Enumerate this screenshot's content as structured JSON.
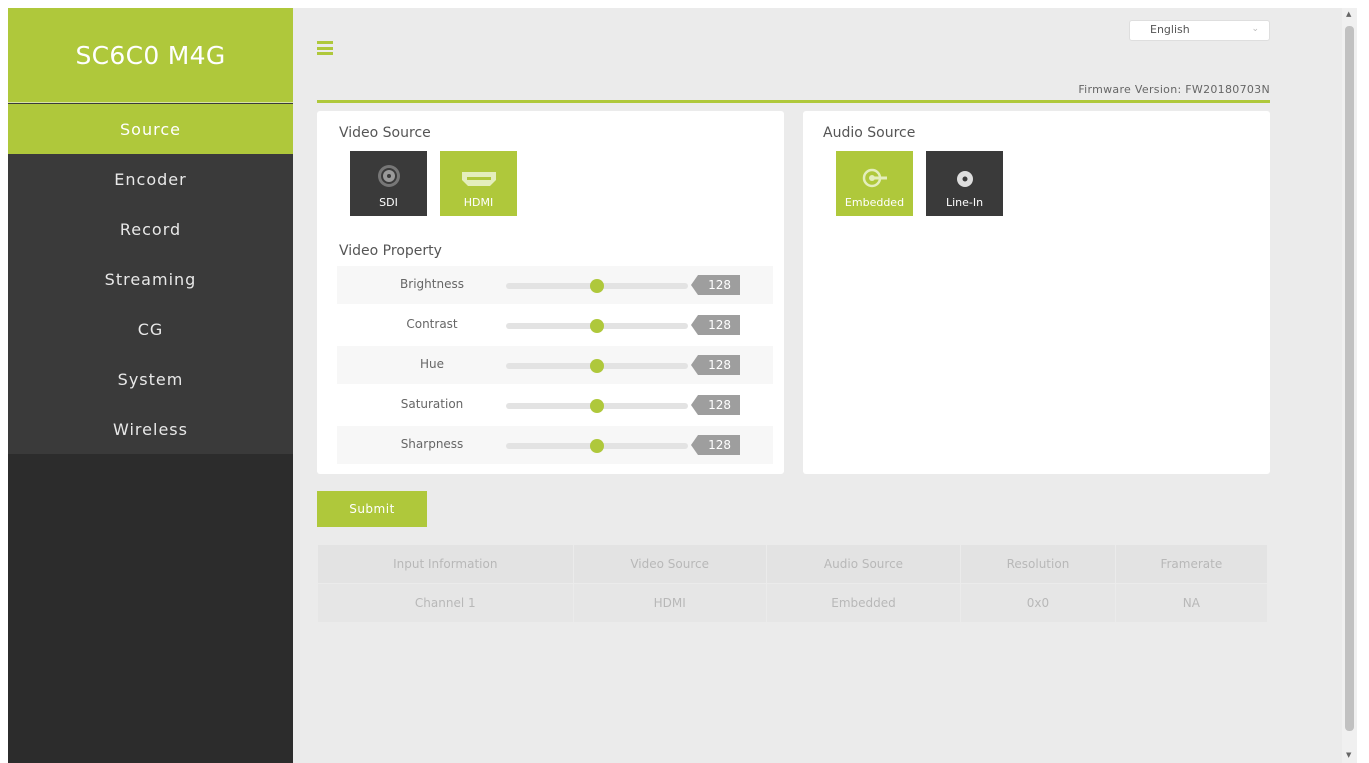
{
  "brand": "SC6C0 M4G",
  "nav": [
    "Source",
    "Encoder",
    "Record",
    "Streaming",
    "CG",
    "System",
    "Wireless"
  ],
  "active_nav": 0,
  "language": "English",
  "firmware": "Firmware Version: FW20180703N",
  "video_source": {
    "title": "Video Source",
    "options": [
      {
        "label": "SDI",
        "selected": false,
        "icon": "sdi-connector-icon"
      },
      {
        "label": "HDMI",
        "selected": true,
        "icon": "hdmi-port-icon"
      }
    ]
  },
  "audio_source": {
    "title": "Audio Source",
    "options": [
      {
        "label": "Embedded",
        "selected": true,
        "icon": "embedded-audio-icon"
      },
      {
        "label": "Line-In",
        "selected": false,
        "icon": "line-in-jack-icon"
      }
    ]
  },
  "video_property": {
    "title": "Video Property",
    "min": 0,
    "max": 255,
    "items": [
      {
        "label": "Brightness",
        "value": "128"
      },
      {
        "label": "Contrast",
        "value": "128"
      },
      {
        "label": "Hue",
        "value": "128"
      },
      {
        "label": "Saturation",
        "value": "128"
      },
      {
        "label": "Sharpness",
        "value": "128"
      }
    ]
  },
  "submit_label": "Submit",
  "info_table": {
    "headers": [
      "Input Information",
      "Video Source",
      "Audio Source",
      "Resolution",
      "Framerate"
    ],
    "rows": [
      [
        "Channel 1",
        "HDMI",
        "Embedded",
        "0x0",
        "NA"
      ]
    ]
  },
  "colors": {
    "accent": "#afc83b",
    "sidebar": "#3a3a3a",
    "button_dark": "#3a3a3a"
  }
}
